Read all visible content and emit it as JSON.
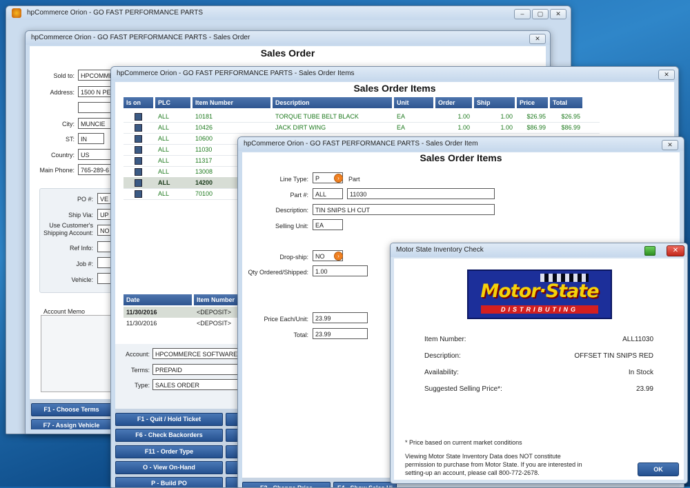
{
  "main_window": {
    "title": "hpCommerce Orion - GO FAST PERFORMANCE PARTS",
    "controls": {
      "minimize": "‒",
      "restore": "▢",
      "close": "✕"
    }
  },
  "sales_order": {
    "title": "hpCommerce Orion - GO FAST PERFORMANCE PARTS - Sales Order",
    "close": "✕",
    "heading": "Sales Order",
    "labels": {
      "sold_to": "Sold to:",
      "address": "Address:",
      "city": "City:",
      "st": "ST:",
      "country": "Country:",
      "main_phone": "Main Phone:",
      "po": "PO #:",
      "ship_via": "Ship Via:",
      "use_customer": "Use Customer's",
      "shipping_account": "Shipping Account:",
      "ref_info": "Ref Info:",
      "job": "Job #:",
      "vehicle": "Vehicle:",
      "account_memo": "Account Memo"
    },
    "values": {
      "sold_to": "HPCOMME",
      "address": "1500 N PE",
      "city": "MUNCIE",
      "st": "IN",
      "country": "US",
      "main_phone": "765-289-6",
      "po": "VE",
      "ship_via": "UP",
      "shipping_account": "NO"
    },
    "buttons": {
      "choose_terms": "F1 - Choose Terms",
      "assign_vehicle": "F7 - Assign Vehicle"
    }
  },
  "sales_order_items": {
    "title": "hpCommerce Orion - GO FAST PERFORMANCE PARTS - Sales Order Items",
    "close": "✕",
    "heading": "Sales Order Items",
    "columns": [
      "Is on PO?",
      "PLC",
      "Item Number",
      "Description",
      "Unit",
      "Order",
      "Ship",
      "Price",
      "Total"
    ],
    "rows": [
      {
        "plc": "ALL",
        "item": "10181",
        "description": "TORQUE TUBE BELT BLACK",
        "unit": "EA",
        "order": "1.00",
        "ship": "1.00",
        "price": "$26.95",
        "total": "$26.95"
      },
      {
        "plc": "ALL",
        "item": "10426",
        "description": "JACK DIRT WING",
        "unit": "EA",
        "order": "1.00",
        "ship": "1.00",
        "price": "$86.99",
        "total": "$86.99"
      },
      {
        "plc": "ALL",
        "item": "10600"
      },
      {
        "plc": "ALL",
        "item": "11030"
      },
      {
        "plc": "ALL",
        "item": "11317"
      },
      {
        "plc": "ALL",
        "item": "13008"
      },
      {
        "plc": "ALL",
        "item": "14200",
        "selected": true
      },
      {
        "plc": "ALL",
        "item": "70100"
      }
    ],
    "history_columns": [
      "Date",
      "Item Number"
    ],
    "history_rows": [
      {
        "date": "11/30/2016",
        "item": "<DEPOSIT>"
      },
      {
        "date": "11/30/2016",
        "item": "<DEPOSIT>"
      }
    ],
    "labels": {
      "account": "Account:",
      "terms": "Terms:",
      "type": "Type:"
    },
    "values": {
      "account": "HPCOMMERCE SOFTWARE",
      "terms": "PREPAID",
      "type": "SALES ORDER"
    },
    "buttons": {
      "quit_hold": "F1 - Quit / Hold Ticket",
      "check_backorders": "F6 - Check Backorders",
      "order_type": "F11 - Order Type",
      "view_on_hand": "O - View On-Hand",
      "build_po": "P - Build PO"
    }
  },
  "sales_order_item": {
    "title": "hpCommerce Orion - GO FAST PERFORMANCE PARTS - Sales Order Item",
    "close": "✕",
    "heading": "Sales Order Items",
    "labels": {
      "line_type": "Line Type:",
      "part": "Part #:",
      "description": "Description:",
      "selling_unit": "Selling Unit:",
      "drop_ship": "Drop-ship:",
      "qty": "Qty Ordered/Shipped:",
      "price_each": "Price Each/Unit:",
      "total": "Total:"
    },
    "values": {
      "line_type": "P",
      "line_type_desc": "Part",
      "plc": "ALL",
      "part": "11030",
      "description": "TIN SNIPS LH CUT",
      "selling_unit": "EA",
      "drop_ship": "NO",
      "qty": "1.00",
      "price_each": "23.99",
      "total": "23.99"
    },
    "buttons": {
      "change_price": "F3 - Change Price",
      "show_sales": "F4 - Show Sales Hi"
    }
  },
  "inventory_check": {
    "title": "Motor State Inventory Check",
    "logo_main": "Motor·State",
    "logo_sub": "DISTRIBUTING",
    "labels": {
      "item_number": "Item Number:",
      "description": "Description:",
      "availability": "Availability:",
      "suggested_price": "Suggested Selling Price*:"
    },
    "values": {
      "item_number": "ALL11030",
      "description": "OFFSET TIN SNIPS RED",
      "availability": "In Stock",
      "suggested_price": "23.99"
    },
    "footnote": "* Price based on current market conditions",
    "disclaimer_1": "Viewing Motor State Inventory Data does NOT constitute",
    "disclaimer_2": "permission to purchase from Motor State.  If you are interested in",
    "disclaimer_3": "setting-up an account, please call 800-772-2678.",
    "ok": "OK"
  },
  "colors": {
    "desktop": "#1f6fb4",
    "header_blue": "#2e5590",
    "button_blue": "#24508f",
    "green_text": "#1e7a1e",
    "selected_row": "#d7ddd5",
    "close_red": "#d8382c"
  }
}
